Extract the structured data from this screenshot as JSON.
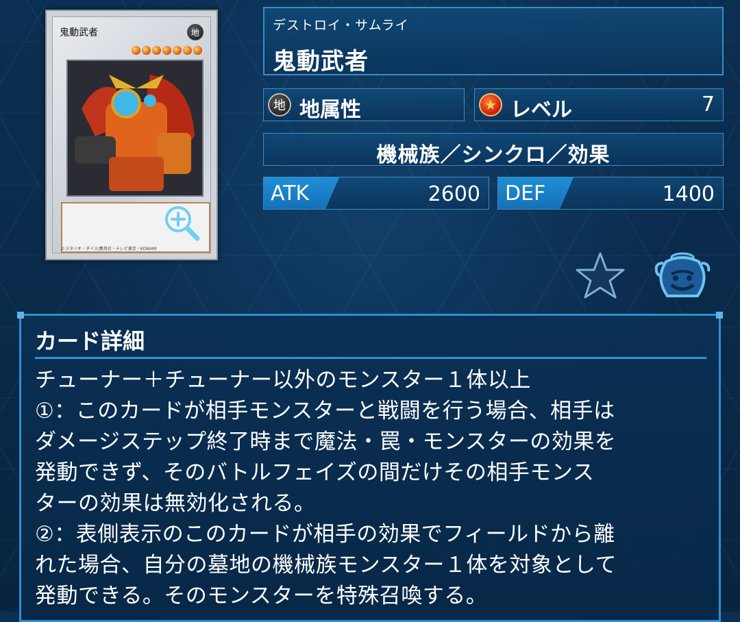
{
  "card": {
    "name_on_card": "鬼動武者",
    "attribute_glyph": "地",
    "level_stars": 7,
    "footer": "©スタジオ・ダイス/集英社・テレビ東京・KONAMI",
    "zoom_icon": "zoom-plus-icon"
  },
  "header": {
    "ruby": "デストロイ・サムライ",
    "name": "鬼動武者"
  },
  "attribute": {
    "icon_glyph": "地",
    "label": "地属性"
  },
  "level": {
    "icon_glyph": "★",
    "label": "レベル",
    "value": "7"
  },
  "type_line": "機械族／シンクロ／効果",
  "stats": {
    "atk_label": "ATK",
    "atk_value": "2600",
    "def_label": "DEF",
    "def_value": "1400"
  },
  "actions": {
    "favorite_icon": "star-icon",
    "deck_icon": "pot-of-greed-icon"
  },
  "detail": {
    "title": "カード詳細",
    "text": "チューナー＋チューナー以外のモンスター１体以上\n①：このカードが相手モンスターと戦闘を行う場合、相手は\nダメージステップ終了時まで魔法・罠・モンスターの効果を\n発動できず、そのバトルフェイズの間だけその相手モンス\nターの効果は無効化される。\n②：表側表示のこのカードが相手の効果でフィールドから離\nれた場合、自分の墓地の機械族モンスター１体を対象として\n発動できる。そのモンスターを特殊召喚する。"
  },
  "colors": {
    "panel_border": "#3b8cc4",
    "stat_tag": "#1f8fd6",
    "background": "#0a2a4a"
  }
}
